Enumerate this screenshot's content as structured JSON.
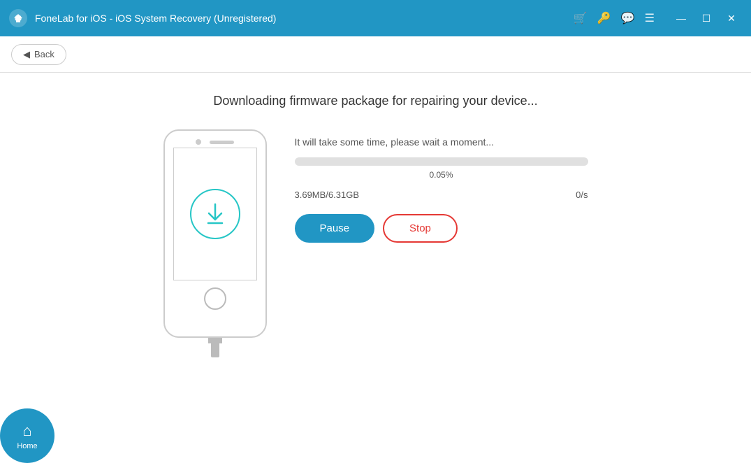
{
  "titleBar": {
    "title": "FoneLab for iOS - iOS System Recovery (Unregistered)",
    "icons": {
      "cart": "🛒",
      "key": "🔑",
      "chat": "💬",
      "menu": "☰"
    },
    "windowControls": {
      "minimize": "—",
      "maximize": "☐",
      "close": "✕"
    }
  },
  "toolbar": {
    "backLabel": "Back"
  },
  "main": {
    "pageTitle": "Downloading firmware package for repairing your device...",
    "waitText": "It will take some time, please wait a moment...",
    "progressPercent": "0.05%",
    "progressValue": 0.05,
    "fileCurrent": "3.69MB/6.31GB",
    "speed": "0/s",
    "pauseLabel": "Pause",
    "stopLabel": "Stop"
  },
  "bottomNav": {
    "homeLabel": "Home"
  }
}
